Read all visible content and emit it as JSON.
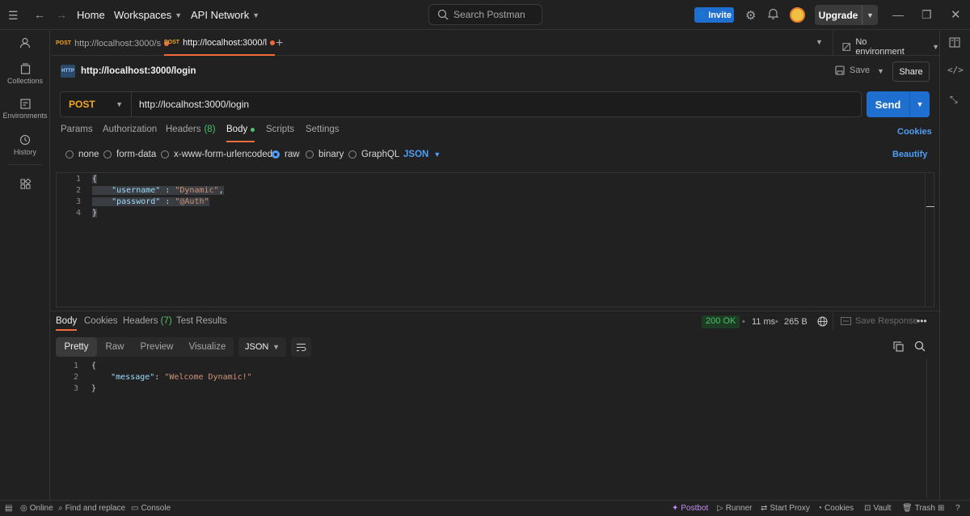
{
  "topbar": {
    "home": "Home",
    "workspaces": "Workspaces",
    "api_network": "API Network",
    "search_placeholder": "Search Postman",
    "invite": "Invite",
    "upgrade": "Upgrade"
  },
  "sidebar": {
    "items": [
      {
        "label": "Collections"
      },
      {
        "label": "Environments"
      },
      {
        "label": "History"
      }
    ]
  },
  "tabs": [
    {
      "method": "POST",
      "label": "http://localhost:3000/s"
    },
    {
      "method": "POST",
      "label": "http://localhost:3000/l"
    }
  ],
  "environment": "No environment",
  "request": {
    "title": "http://localhost:3000/login",
    "save": "Save",
    "share": "Share",
    "method": "POST",
    "url": "http://localhost:3000/login",
    "send": "Send",
    "tabs": [
      "Params",
      "Authorization",
      "Headers",
      "Body",
      "Scripts",
      "Settings"
    ],
    "headers_count": "(8)",
    "cookies": "Cookies",
    "body_types": [
      "none",
      "form-data",
      "x-www-form-urlencoded",
      "raw",
      "binary",
      "GraphQL"
    ],
    "body_format": "JSON",
    "beautify": "Beautify",
    "body_lines": [
      "1",
      "2",
      "3",
      "4"
    ],
    "body_code": {
      "open": "{",
      "k1": "\"username\"",
      "sep": " : ",
      "v1": "\"Dynamic\"",
      "comma": ",",
      "k2": "\"password\"",
      "v2": "\"@Auth\"",
      "close": "}"
    }
  },
  "response": {
    "tabs": [
      "Body",
      "Cookies",
      "Headers",
      "Test Results"
    ],
    "headers_count": "(7)",
    "status": "200 OK",
    "time": "11 ms",
    "size": "265 B",
    "save_response": "Save Response",
    "views": [
      "Pretty",
      "Raw",
      "Preview",
      "Visualize"
    ],
    "format": "JSON",
    "lines": [
      "1",
      "2",
      "3"
    ],
    "code": {
      "open": "{",
      "key": "\"message\"",
      "colon": ": ",
      "value": "\"Welcome Dynamic!\"",
      "close": "}"
    }
  },
  "footer": {
    "online": "Online",
    "find_replace": "Find and replace",
    "console": "Console",
    "postbot": "Postbot",
    "runner": "Runner",
    "start_proxy": "Start Proxy",
    "cookies": "Cookies",
    "vault": "Vault",
    "trash": "Trash"
  },
  "colors": {
    "accent": "#f26b3a",
    "primary": "#1f6fd1",
    "method_post": "#f5a623",
    "status_ok": "#4cc26b"
  }
}
